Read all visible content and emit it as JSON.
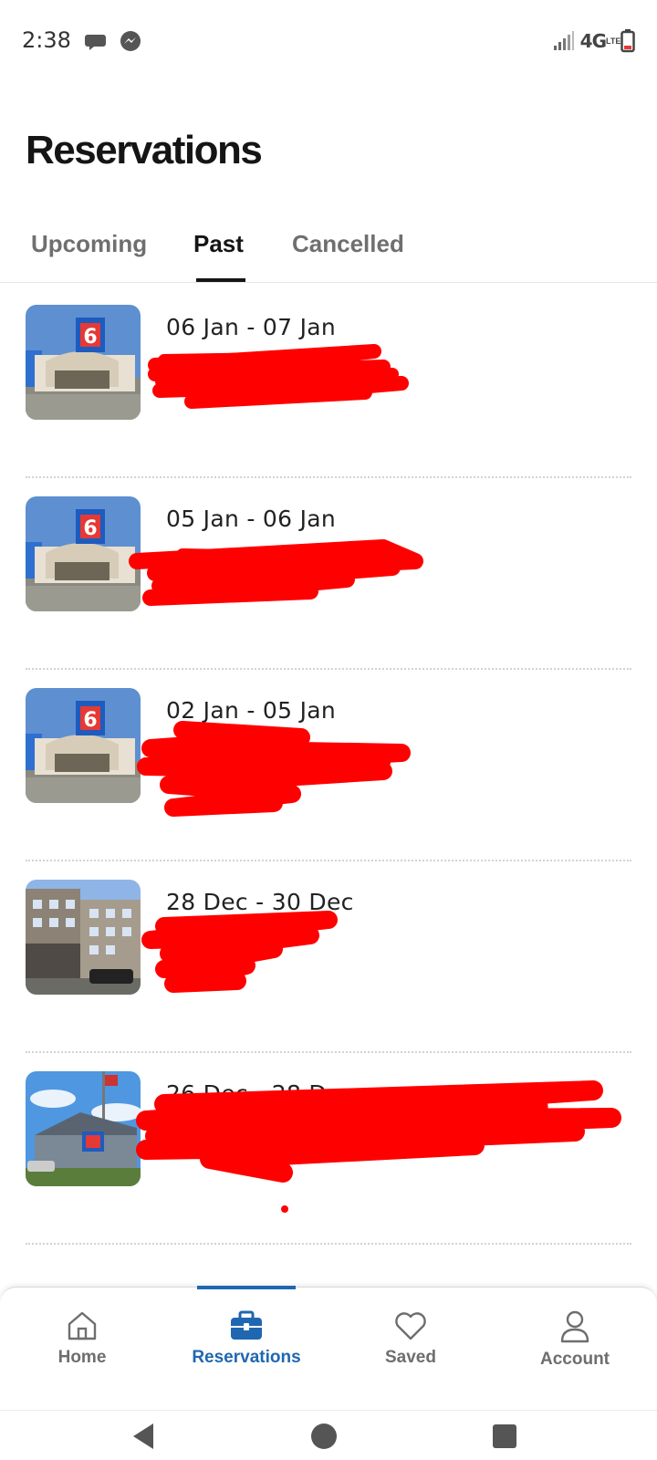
{
  "status_bar": {
    "time": "2:38",
    "network": "4G",
    "network_sub": "LTE"
  },
  "page": {
    "title": "Reservations"
  },
  "tabs": [
    {
      "label": "Upcoming",
      "active": false
    },
    {
      "label": "Past",
      "active": true
    },
    {
      "label": "Cancelled",
      "active": false
    }
  ],
  "reservations": [
    {
      "dates": "06 Jan - 07 Jan",
      "thumbnail": "motel6-front-entrance"
    },
    {
      "dates": "05 Jan - 06 Jan",
      "thumbnail": "motel6-front-entrance"
    },
    {
      "dates": "02 Jan - 05 Jan",
      "thumbnail": "motel6-front-entrance"
    },
    {
      "dates": "28 Dec - 30 Dec",
      "thumbnail": "multi-story-hotel-building"
    },
    {
      "dates": "26 Dec - 28 Dec",
      "thumbnail": "motel6-building-with-flag"
    }
  ],
  "bottom_nav": [
    {
      "label": "Home",
      "icon": "home-icon",
      "active": false
    },
    {
      "label": "Reservations",
      "icon": "briefcase-icon",
      "active": true
    },
    {
      "label": "Saved",
      "icon": "heart-icon",
      "active": false
    },
    {
      "label": "Account",
      "icon": "person-icon",
      "active": false
    }
  ],
  "colors": {
    "accent": "#1f67b1",
    "redaction": "#ff0000",
    "text_primary": "#151515",
    "text_muted": "#6f6f6f"
  }
}
